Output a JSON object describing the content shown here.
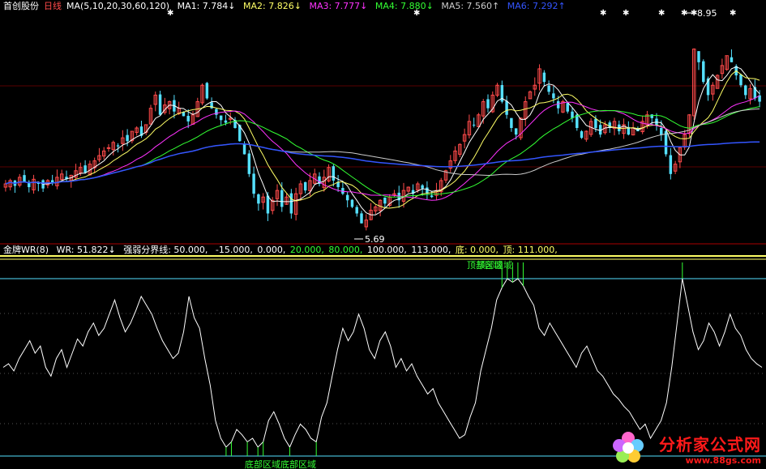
{
  "header": {
    "stock_name": "首创股份",
    "period": "日线",
    "ma_formula": "MA(5,10,20,30,60,120)",
    "ma_items": [
      {
        "text": "MA1: 7.784↓",
        "color": "#ffffff"
      },
      {
        "text": "MA2: 7.826↓",
        "color": "#ffff66"
      },
      {
        "text": "MA3: 7.777↓",
        "color": "#ff33ff"
      },
      {
        "text": "MA4: 7.880↓",
        "color": "#33ff33"
      },
      {
        "text": "MA5: 7.560↑",
        "color": "#cccccc"
      },
      {
        "text": "MA6: 7.292↑",
        "color": "#3355ff"
      }
    ]
  },
  "wr_header": {
    "name": "金牌WR(8)",
    "items": [
      {
        "text": "WR: 51.822↓",
        "color": "#ffffff"
      },
      {
        "text": "强弱分界线: 50.000,",
        "color": "#ffffff"
      },
      {
        "text": "-15.000,",
        "color": "#ffffff"
      },
      {
        "text": "0.000,",
        "color": "#ffffff"
      },
      {
        "text": "20.000,",
        "color": "#33ff33"
      },
      {
        "text": "80.000,",
        "color": "#33ff33"
      },
      {
        "text": "100.000,",
        "color": "#ffffff"
      },
      {
        "text": "113.000,",
        "color": "#ffffff"
      },
      {
        "text": "底: 0.000,",
        "color": "#ffff66"
      },
      {
        "text": "顶: 111.000,",
        "color": "#ffff66"
      }
    ]
  },
  "annotations": {
    "high_label": "8.95",
    "low_label": "5.69",
    "top_zone_label": "顶部区域",
    "bottom_zone_label": "底部区域"
  },
  "watermark": {
    "title": "分析家公式网",
    "url": "www.88gs.com"
  },
  "colors": {
    "up": "#ff4a4a",
    "down": "#55e0ff",
    "ma1": "#ffffff",
    "ma2": "#ffff66",
    "ma3": "#ff33ff",
    "ma4": "#33ff33",
    "ma5": "#cccccc",
    "ma6": "#3355ff",
    "wr_line": "#ffffff",
    "zone": "#33ff33"
  },
  "chart_data": [
    {
      "type": "candlestick",
      "series_count": 6,
      "high": 8.95,
      "low": 5.69,
      "closes": [
        6.45,
        6.5,
        6.42,
        6.55,
        6.48,
        6.4,
        6.52,
        6.45,
        6.38,
        6.5,
        6.46,
        6.55,
        6.6,
        6.52,
        6.58,
        6.65,
        6.7,
        6.62,
        6.75,
        6.8,
        6.88,
        6.95,
        7.0,
        7.08,
        7.02,
        7.15,
        7.1,
        7.25,
        7.3,
        7.18,
        7.35,
        7.6,
        7.8,
        7.5,
        7.65,
        7.7,
        7.55,
        7.6,
        7.48,
        7.4,
        7.5,
        7.7,
        7.95,
        7.75,
        7.6,
        7.5,
        7.42,
        7.38,
        7.45,
        7.3,
        7.1,
        6.9,
        6.6,
        6.3,
        6.15,
        6.25,
        6.0,
        6.2,
        6.35,
        6.1,
        6.25,
        6.0,
        6.3,
        6.45,
        6.35,
        6.5,
        6.6,
        6.45,
        6.55,
        6.7,
        6.5,
        6.4,
        6.3,
        6.2,
        6.1,
        6.0,
        5.85,
        5.9,
        6.05,
        6.1,
        6.2,
        6.15,
        6.25,
        6.3,
        6.2,
        6.35,
        6.4,
        6.3,
        6.45,
        6.38,
        6.3,
        6.25,
        6.35,
        6.5,
        6.65,
        6.8,
        6.95,
        7.05,
        7.2,
        7.4,
        7.35,
        7.5,
        7.7,
        7.6,
        7.8,
        7.95,
        7.7,
        7.5,
        7.3,
        7.2,
        7.45,
        7.7,
        7.85,
        7.95,
        8.2,
        8.0,
        7.85,
        7.75,
        7.6,
        7.7,
        7.55,
        7.45,
        7.3,
        7.15,
        7.25,
        7.4,
        7.3,
        7.2,
        7.35,
        7.3,
        7.4,
        7.25,
        7.35,
        7.2,
        7.3,
        7.25,
        7.4,
        7.5,
        7.45,
        7.35,
        7.2,
        6.9,
        6.6,
        6.75,
        7.0,
        7.2,
        7.5,
        8.5,
        8.3,
        8.0,
        7.8,
        7.95,
        8.1,
        8.25,
        8.4,
        8.3,
        8.1,
        7.95,
        7.8,
        7.9,
        7.75,
        7.7
      ]
    },
    {
      "type": "line",
      "name": "WR",
      "ylim": [
        -15,
        113
      ],
      "values": [
        50,
        52,
        48,
        55,
        60,
        65,
        58,
        62,
        50,
        45,
        55,
        60,
        50,
        58,
        66,
        62,
        70,
        75,
        68,
        72,
        80,
        88,
        78,
        70,
        75,
        82,
        90,
        85,
        80,
        72,
        65,
        60,
        55,
        58,
        70,
        90,
        78,
        72,
        55,
        40,
        20,
        10,
        5,
        8,
        15,
        12,
        8,
        10,
        5,
        8,
        20,
        25,
        18,
        10,
        5,
        12,
        18,
        15,
        10,
        8,
        22,
        30,
        45,
        60,
        72,
        65,
        70,
        80,
        72,
        60,
        55,
        65,
        70,
        62,
        50,
        55,
        48,
        52,
        45,
        40,
        35,
        38,
        30,
        25,
        20,
        15,
        10,
        12,
        22,
        30,
        48,
        60,
        72,
        88,
        95,
        100,
        98,
        100,
        96,
        90,
        85,
        72,
        68,
        75,
        70,
        65,
        60,
        55,
        50,
        58,
        62,
        55,
        48,
        45,
        40,
        35,
        32,
        28,
        25,
        20,
        15,
        18,
        10,
        15,
        20,
        30,
        50,
        75,
        100,
        85,
        70,
        60,
        65,
        75,
        70,
        62,
        70,
        80,
        72,
        68,
        60,
        55,
        52,
        50
      ]
    },
    {
      "type": "text-annotations",
      "series": [
        {
          "name": "金牌WR(8)",
          "labels": [
            "WR",
            "强弱分界线"
          ]
        }
      ]
    }
  ]
}
